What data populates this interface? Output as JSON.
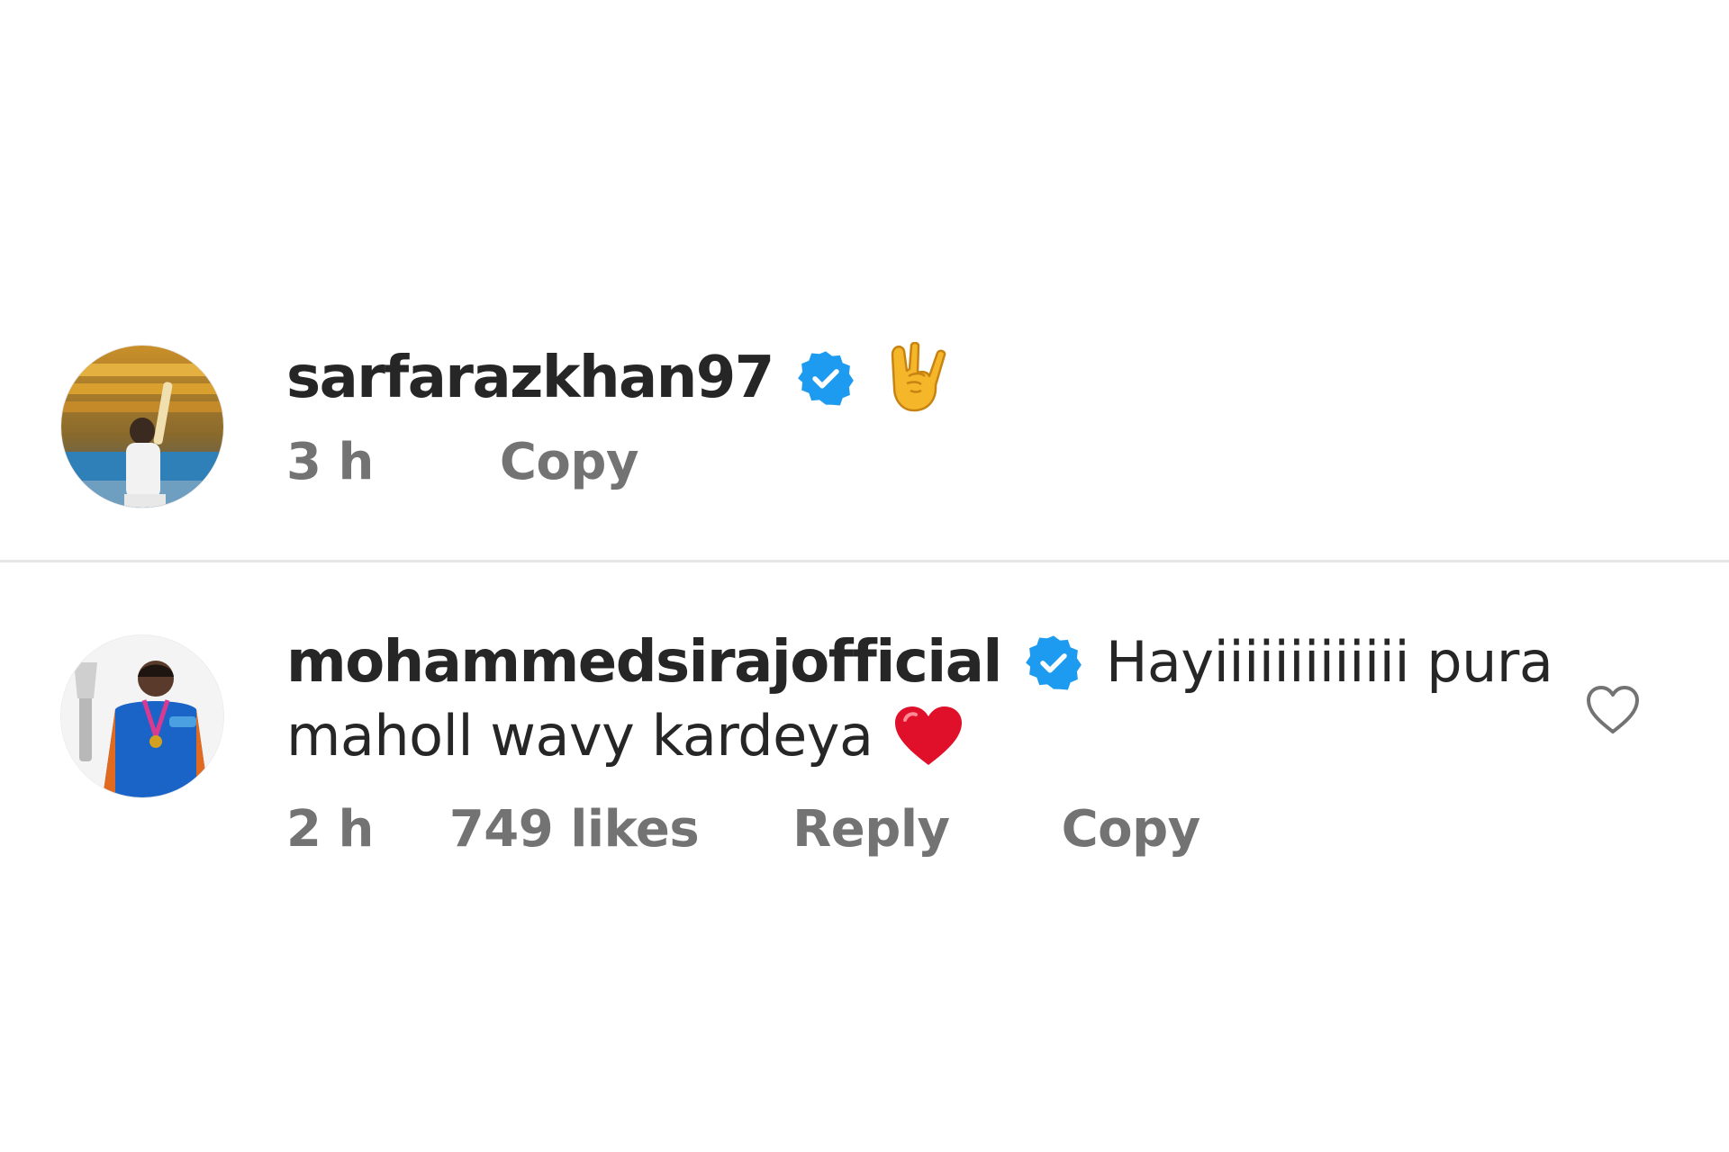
{
  "comments": [
    {
      "username": "sarfarazkhan97",
      "verified_icon": "verified-badge-icon",
      "text_emoji": "rock-on-hand-emoji",
      "time": "3 h",
      "copy_label": "Copy"
    },
    {
      "username": "mohammedsirajofficial",
      "verified_icon": "verified-badge-icon",
      "text_line1": "Hayiiiiiiiiiiiii pura",
      "text_line2": "maholl wavy kardeya",
      "text_emoji": "red-heart-emoji",
      "time": "2 h",
      "likes": "749 likes",
      "reply_label": "Reply",
      "copy_label": "Copy",
      "like_icon": "heart-outline-icon"
    }
  ],
  "colors": {
    "username": "#262626",
    "meta": "#737373",
    "verified": "#1d9bf0",
    "divider": "#e6e6e6",
    "heart_emoji": "#e0102a"
  }
}
